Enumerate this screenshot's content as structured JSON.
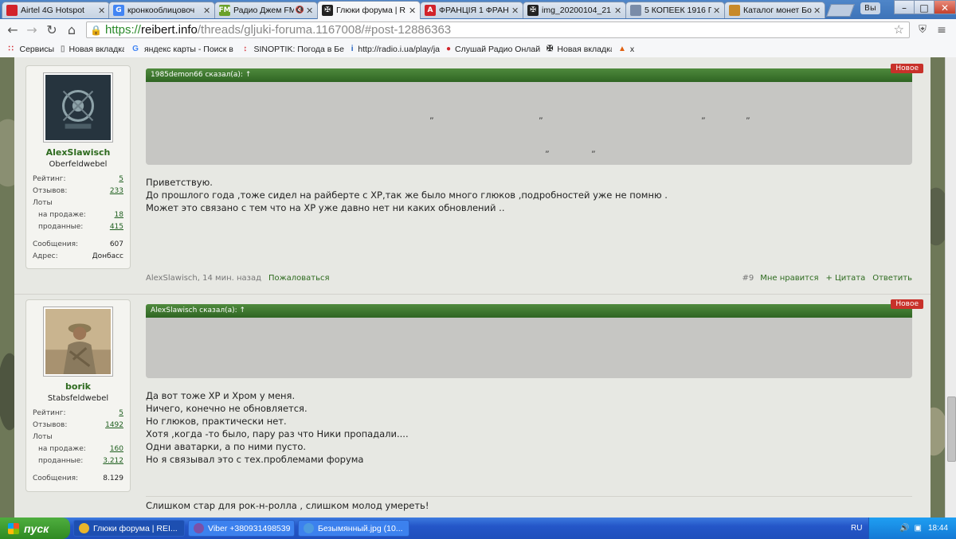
{
  "tabs": [
    {
      "title": "Airtel 4G Hotspot",
      "favicon": "airtel",
      "color": "#d2232a",
      "active": false
    },
    {
      "title": "кронкооблицовоч",
      "favicon": "G",
      "color": "#4285f4",
      "active": false
    },
    {
      "title": "Радио Джем FM",
      "favicon": "FM",
      "color": "#6aa12a",
      "active": false,
      "muted_icon": "🔇"
    },
    {
      "title": "Глюки форума | R",
      "favicon": "✠",
      "color": "#222222",
      "active": true
    },
    {
      "title": "ФРАНЦІЯ 1 ФРАН",
      "favicon": "A",
      "color": "#d2232a",
      "active": false
    },
    {
      "title": "img_20200104_21",
      "favicon": "✠",
      "color": "#222222",
      "active": false
    },
    {
      "title": "5 КОПЕЕК 1916 Г",
      "favicon": "doc",
      "color": "#7a8ca8",
      "active": false
    },
    {
      "title": "Каталог монет Бо",
      "favicon": "coin",
      "color": "#c88a2a",
      "active": false
    }
  ],
  "window": {
    "profile_label": "Вы",
    "min": "–",
    "max": "□",
    "close": "✕"
  },
  "toolbar": {
    "url_scheme": "https://",
    "url_host": "reibert.info",
    "url_path": "/threads/gljuki-foruma.1167008/#post-12886363"
  },
  "bookmarks": [
    {
      "label": "Сервисы",
      "icon": "apps-grid",
      "color": "#d2232a"
    },
    {
      "label": "Новая вкладка",
      "icon": "page",
      "color": "#888"
    },
    {
      "label": "яндекс карты - Поиск в",
      "icon": "G",
      "color": "#4285f4"
    },
    {
      "label": "SINOPTIK: Погода в Бе",
      "icon": "thermometer",
      "color": "#d2232a"
    },
    {
      "label": "http://radio.i.ua/play/ja",
      "icon": "i",
      "color": "#1f5fbf"
    },
    {
      "label": "Слушай Радио Онлайн",
      "icon": "airtel",
      "color": "#d2232a"
    },
    {
      "label": "Новая вкладка",
      "icon": "✠",
      "color": "#222"
    },
    {
      "label": "x",
      "icon": "flame",
      "color": "#e06010"
    }
  ],
  "posts": [
    {
      "username": "AlexSlawisch",
      "rank": "Oberfeldwebel",
      "stats": [
        {
          "label": "Рейтинг:",
          "value": "5",
          "link": true,
          "indent": false
        },
        {
          "label": "Отзывов:",
          "value": "233",
          "link": true,
          "indent": false
        },
        {
          "label": "Лоты",
          "value": "",
          "link": false,
          "indent": false
        },
        {
          "label": "на продаже:",
          "value": "18",
          "link": true,
          "indent": true
        },
        {
          "label": "проданные:",
          "value": "415",
          "link": true,
          "indent": true
        },
        {
          "label": "Сообщения:",
          "value": "607",
          "link": false,
          "indent": false
        },
        {
          "label": "Адрес:",
          "value": "Донбасс",
          "link": false,
          "indent": false
        }
      ],
      "badge": "Новое",
      "quote_author": "1985demon66 сказал(а): ↑",
      "text_lines": [
        "Приветствую.",
        "До прошлого года ,тоже сидел на райберте с ХР,так же было много глюков ,подробностей уже не помню .",
        "Может это связано с тем что на ХР уже давно нет ни каких обновлений .."
      ],
      "footer_author": "AlexSlawisch, 14 мин. назад",
      "report": "Пожаловаться",
      "post_number": "#9",
      "like": "Мне нравится",
      "quote": "+ Цитата",
      "reply": "Ответить"
    },
    {
      "username": "borik",
      "rank": "Stabsfeldwebel",
      "stats": [
        {
          "label": "Рейтинг:",
          "value": "5",
          "link": true,
          "indent": false
        },
        {
          "label": "Отзывов:",
          "value": "1492",
          "link": true,
          "indent": false
        },
        {
          "label": "Лоты",
          "value": "",
          "link": false,
          "indent": false
        },
        {
          "label": "на продаже:",
          "value": "160",
          "link": true,
          "indent": true
        },
        {
          "label": "проданные:",
          "value": "3.212",
          "link": true,
          "indent": true
        },
        {
          "label": "Сообщения:",
          "value": "8.129",
          "link": false,
          "indent": false
        }
      ],
      "badge": "Новое",
      "quote_author": "AlexSlawisch сказал(а): ↑",
      "text_lines": [
        "Да вот тоже ХР и Хром у меня.",
        "Ничего, конечно не обновляется.",
        "Но глюков, практически нет.",
        "Хотя ,когда -то было, пару раз что Ники пропадали....",
        "Одни аватарки, а по ними пусто.",
        "Но я связывал это с тех.проблемами форума"
      ],
      "signature": "Слишком стар для рок-н-ролла , слишком молод умереть!"
    }
  ],
  "taskbar": {
    "start_label": "пуск",
    "tasks": [
      {
        "label": "Глюки форума | REI...",
        "icon_color": "#e9b52a",
        "active": true
      },
      {
        "label": "Viber +380931498539",
        "icon_color": "#7b51a8",
        "active": false
      },
      {
        "label": "Безымянный.jpg (10...",
        "icon_color": "#4c9ae0",
        "active": false
      }
    ],
    "lang": "RU",
    "clock": "18:44"
  }
}
